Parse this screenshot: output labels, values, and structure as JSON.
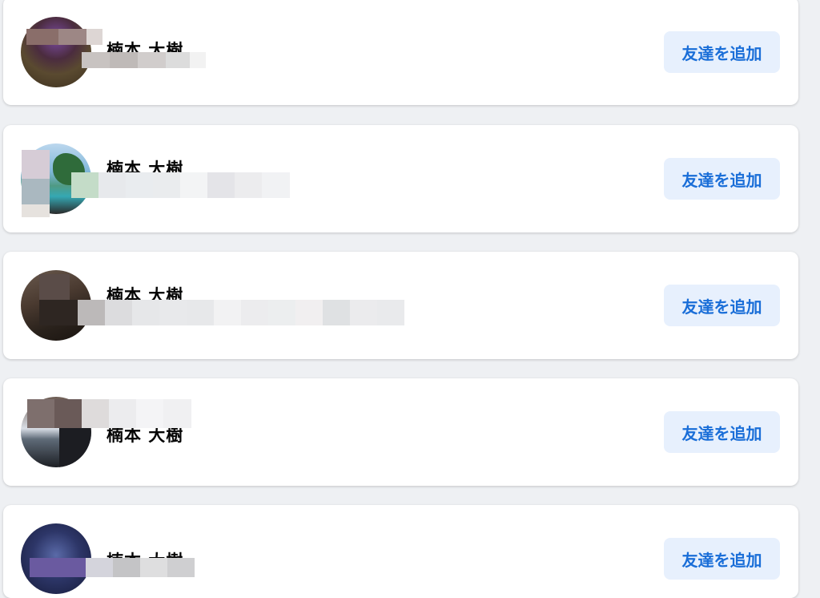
{
  "friend_suggestions": [
    {
      "name": "楠本 大樹",
      "button_label": "友達を追加"
    },
    {
      "name": "楠本 大樹",
      "button_label": "友達を追加"
    },
    {
      "name": "楠本 大樹",
      "button_label": "友達を追加"
    },
    {
      "name": "楠本 大樹",
      "button_label": "友達を追加"
    },
    {
      "name": "楠本 大樹",
      "button_label": "友達を追加"
    }
  ],
  "colors": {
    "page_background": "#eef0f3",
    "card_background": "#ffffff",
    "button_background": "#e7f0fd",
    "button_text": "#1a6ed8"
  }
}
